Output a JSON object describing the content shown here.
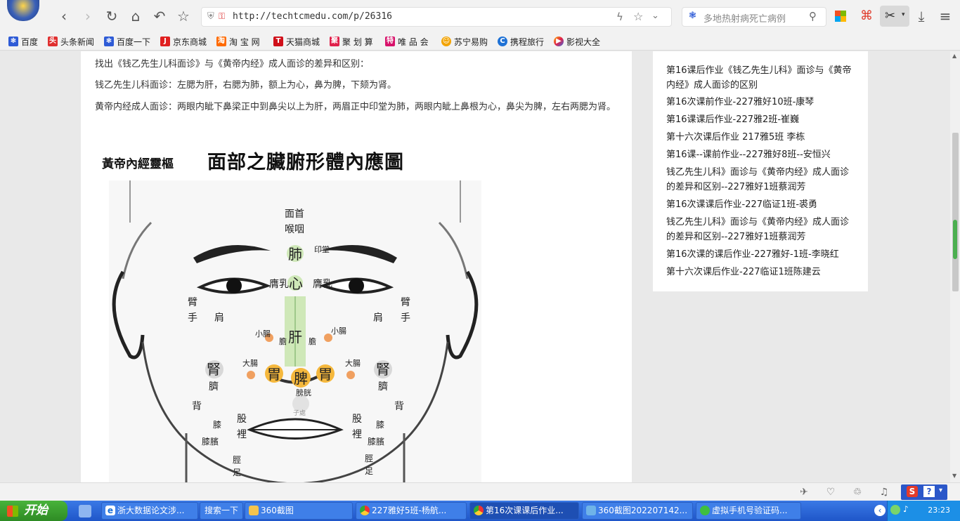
{
  "browser": {
    "url": "http://techtcmedu.com/p/26316",
    "search_placeholder": "多地热射病死亡病例"
  },
  "bookmarks": [
    {
      "label": "百度",
      "icon": "baidu-icon",
      "color": "#2e5bd6"
    },
    {
      "label": "头条新闻",
      "icon": "toutiao-icon",
      "color": "#e03030"
    },
    {
      "label": "百度一下",
      "icon": "baidu-paw-icon",
      "color": "#2e5bd6"
    },
    {
      "label": "京东商城",
      "icon": "jd-icon",
      "color": "#e02020"
    },
    {
      "label": "淘 宝 网",
      "icon": "taobao-icon",
      "color": "#ff6a00"
    },
    {
      "label": "天猫商城",
      "icon": "tmall-icon",
      "color": "#d0101a"
    },
    {
      "label": "聚 划 算",
      "icon": "juhuasuan-icon",
      "color": "#e0204a"
    },
    {
      "label": "唯 品 会",
      "icon": "vip-icon",
      "color": "#d7136b"
    },
    {
      "label": "苏宁易购",
      "icon": "suning-icon",
      "color": "#f3a300"
    },
    {
      "label": "携程旅行",
      "icon": "ctrip-icon",
      "color": "#1f72d6"
    },
    {
      "label": "影视大全",
      "icon": "video-icon",
      "color": "#7a3be0"
    }
  ],
  "article": {
    "line1": "找出《钱乙先生儿科面诊》与《黄帝内经》成人面诊的差异和区别：",
    "line2": "钱乙先生儿科面诊：左腮为肝，右腮为肺，额上为心，鼻为脾，下颏为肾。",
    "line3": "黄帝内经成人面诊：两眼内眦下鼻梁正中到鼻尖以上为肝，两眉正中印堂为肺，两眼内眦上鼻根为心，鼻尖为脾，左右两腮为肾。"
  },
  "figure": {
    "subtitle": "黃帝內經靈樞",
    "title": "面部之臟腑形體內應圖",
    "labels": {
      "mian_shou": "面首",
      "hou_yan": "喉咽",
      "fei": "肺",
      "yin_tang": "印堂",
      "xin": "心",
      "ying_ru": "膺乳",
      "bi": "臂",
      "shou": "手",
      "jian": "肩",
      "gan": "肝",
      "dan": "膽",
      "xiao_chang": "小腸",
      "da_chang": "大腸",
      "shen": "腎",
      "qi": "臍",
      "wei": "胃",
      "pi": "脾",
      "pang_guang": "膀胱",
      "zi_chu": "子處",
      "bei": "背",
      "gu": "股",
      "li": "裡",
      "xi": "膝",
      "xi_bin": "膝臏",
      "jing": "脛",
      "zu": "足"
    }
  },
  "sidebar": {
    "links": [
      "第16课后作业《钱乙先生儿科》面诊与《黄帝内经》成人面诊的区别",
      "第16次课前作业-227雅好10班-康琴",
      "第16课课后作业-227雅2班-崔巍",
      "第十六次课后作业 217雅5班 李栋",
      "第16课--课前作业--227雅好8班--安恒兴",
      "钱乙先生儿科》面诊与《黄帝内经》成人面诊的差异和区别--227雅好1班蔡润芳",
      "第16次课课后作业-227临证1班-裘勇",
      "钱乙先生儿科》面诊与《黄帝内经》成人面诊的差异和区别--227雅好1班蔡润芳",
      "第16次课的课后作业-227雅好-1班-李晓红",
      "第十六次课后作业-227临证1班陈建云"
    ]
  },
  "taskbar": {
    "start": "开始",
    "items": [
      "浙大数据论文涉...",
      "搜索一下",
      "360截图",
      "227雅好5班-杨航...",
      "第16次课课后作业...",
      "360截图202207142...",
      "虚拟手机号验证码..."
    ],
    "clock": "23:23"
  },
  "colors": {
    "accent_green": "#4caf50",
    "organ_yellow": "#f5b83d",
    "organ_orange": "#f0a060",
    "organ_green": "#cfe8b8"
  }
}
